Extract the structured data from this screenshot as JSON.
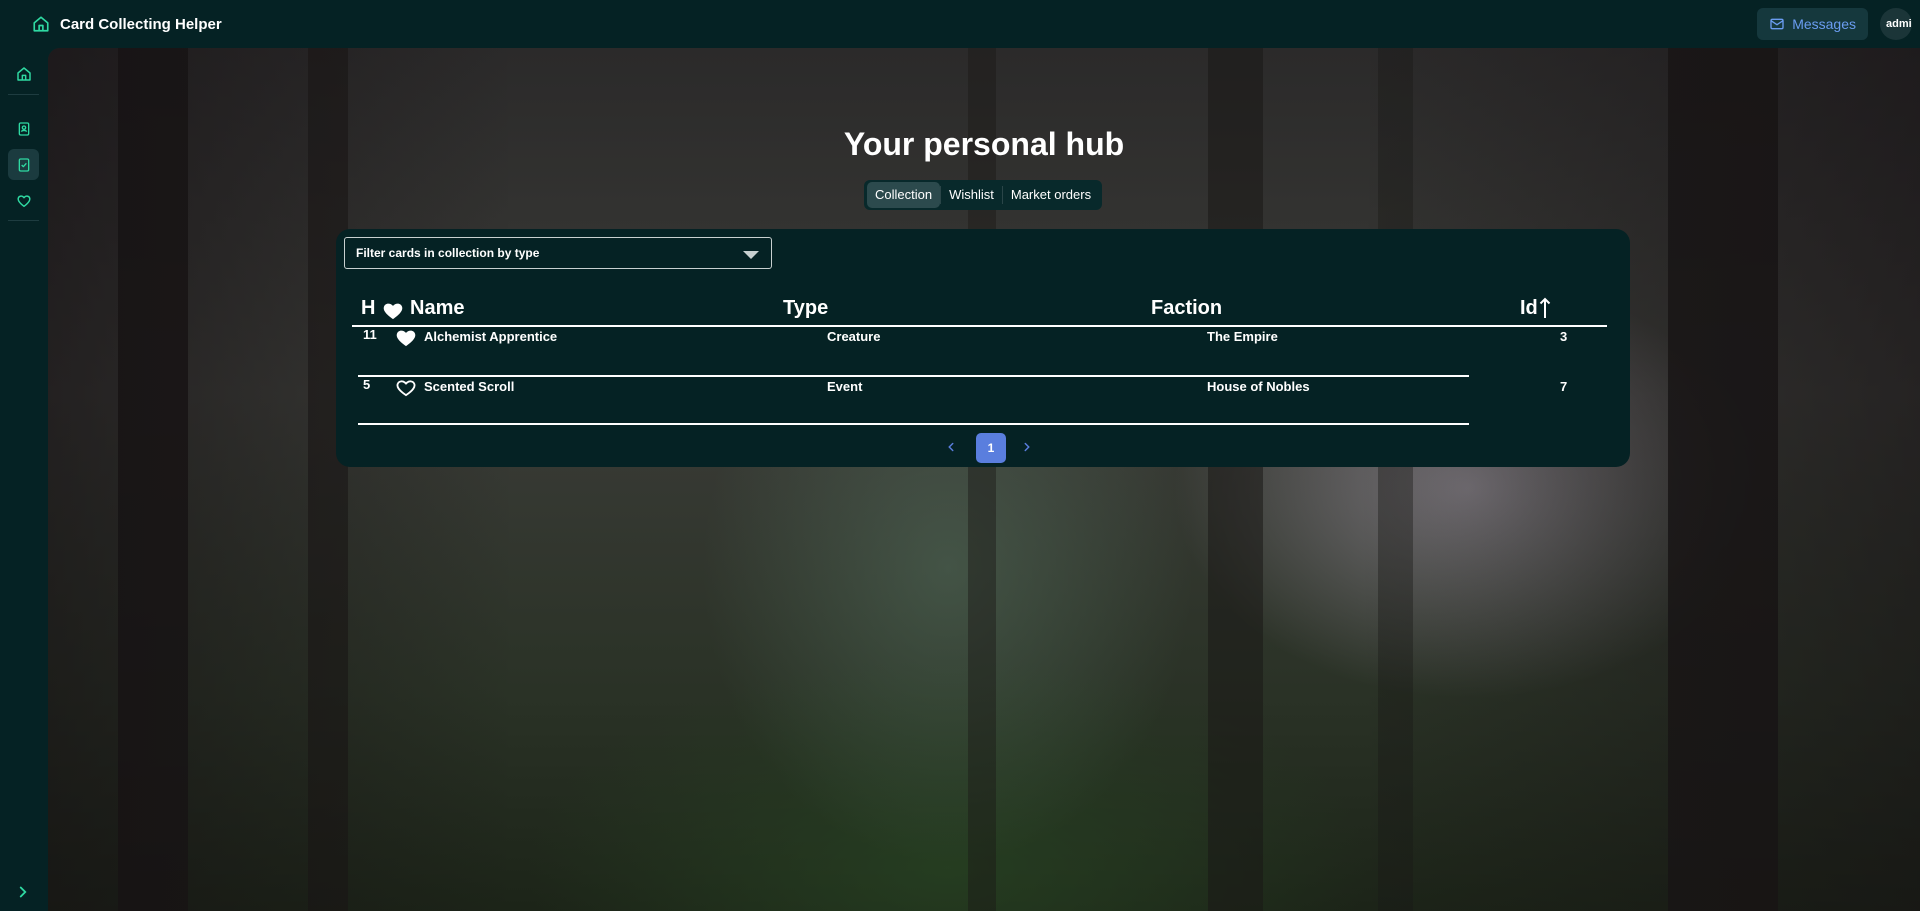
{
  "app": {
    "title": "Card Collecting Helper"
  },
  "header": {
    "messages_label": "Messages",
    "avatar_text": "admin"
  },
  "sidebar": {
    "items": [
      {
        "icon": "home-icon"
      },
      {
        "icon": "card-book-icon"
      },
      {
        "icon": "checklist-icon",
        "active": true
      },
      {
        "icon": "heart-icon"
      }
    ],
    "expand_icon": "chevron-right-icon"
  },
  "hero": {
    "title": "Your personal hub"
  },
  "tabs": [
    {
      "label": "Collection",
      "active": true
    },
    {
      "label": "Wishlist"
    },
    {
      "label": "Market orders"
    }
  ],
  "filter": {
    "placeholder": "Filter cards in collection by type"
  },
  "table": {
    "columns": {
      "h": "H",
      "name": "Name",
      "type": "Type",
      "faction": "Faction",
      "id": "Id"
    },
    "rows": [
      {
        "h": "11",
        "favorite": true,
        "name": "Alchemist Apprentice",
        "type": "Creature",
        "faction": "The Empire",
        "id": "3"
      },
      {
        "h": "5",
        "favorite": false,
        "name": "Scented Scroll",
        "type": "Event",
        "faction": "House of Nobles",
        "id": "7"
      }
    ]
  },
  "pagination": {
    "current_page": "1"
  },
  "colors": {
    "accent": "#2fd9a2",
    "background": "#052224",
    "page_active": "#5a7ede",
    "messages_text": "#6a9cf0"
  }
}
